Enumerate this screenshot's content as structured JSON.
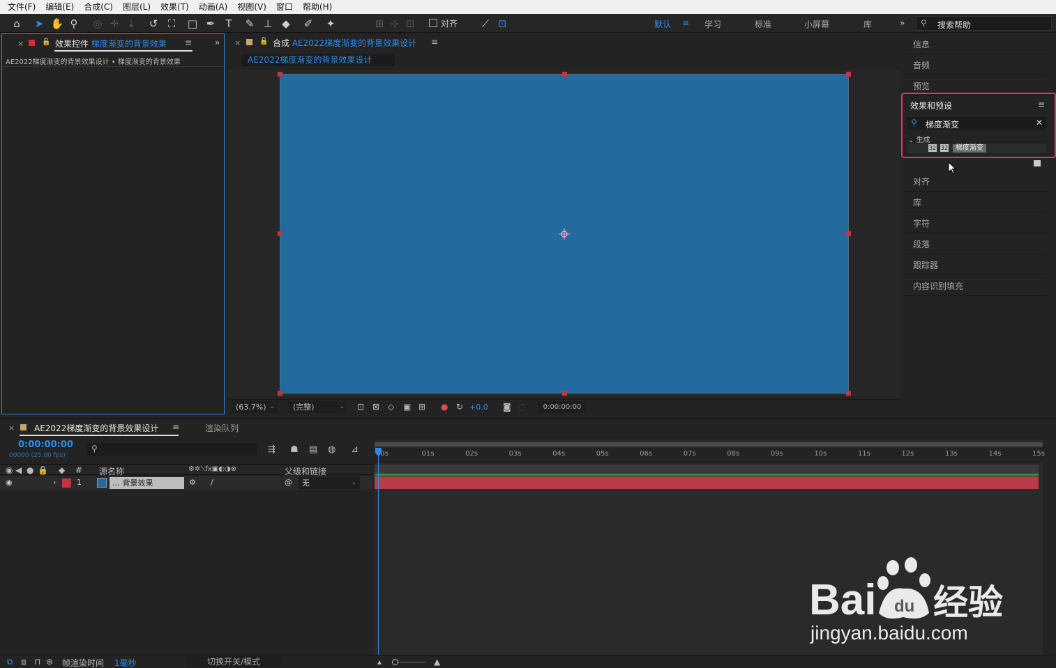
{
  "menu": [
    "文件(F)",
    "编辑(E)",
    "合成(C)",
    "图层(L)",
    "效果(T)",
    "动画(A)",
    "视图(V)",
    "窗口",
    "帮助(H)"
  ],
  "toolbar": {
    "align_label": "对齐",
    "workspaces": [
      "默认",
      "学习",
      "标准",
      "小屏幕",
      "库"
    ],
    "help_search": "搜索帮助",
    "icons": [
      "home-icon",
      "selection-arrow-icon",
      "hand-icon",
      "zoom-icon",
      "rotate-icon",
      "rectangle-icon",
      "pen-icon",
      "type-icon",
      "brush-icon",
      "stamp-icon",
      "eraser-icon",
      "puppet-icon",
      "pin-icon"
    ]
  },
  "effect_controls": {
    "tab_prefix": "效果控件",
    "tab_layer": "梯度渐变的背景效果",
    "subtitle": "AE2022梯度渐变的背景效果设计 • 梯度渐变的背景效果",
    "swatch_color": "#c8323a"
  },
  "composition": {
    "tab_prefix": "合成",
    "tab_name": "AE2022梯度渐变的背景效果设计",
    "breadcrumb": "AE2022梯度渐变的背景效果设计",
    "swatch_color": "#c9a66b",
    "background_color": "#236a9f",
    "zoom": "(63.7%)",
    "resolution": "(完整)",
    "exposure": "+0.0",
    "timecode": "0:00:00:00"
  },
  "right_panels": {
    "top": [
      "信息",
      "音频",
      "预览"
    ],
    "effects_presets": {
      "title": "效果和预设",
      "search_value": "梯度渐变",
      "category": "生成",
      "result": "梯度渐变"
    },
    "bottom": [
      "对齐",
      "库",
      "字符",
      "段落",
      "跟踪器",
      "内容识别填充"
    ]
  },
  "timeline": {
    "tab_name": "AE2022梯度渐变的背景效果设计",
    "render_queue": "渲染队列",
    "current_time": "0:00:00:00",
    "fps": "00000 (25.00 fps)",
    "col_source": "源名称",
    "col_hash": "#",
    "col_parent": "父级和链接",
    "layer": {
      "index": "1",
      "name": "… 背景效果",
      "parent": "无",
      "label_color": "#c8323a",
      "solid_color": "#236a9f"
    },
    "ruler": [
      "0s",
      "01s",
      "02s",
      "03s",
      "04s",
      "05s",
      "06s",
      "07s",
      "08s",
      "09s",
      "10s",
      "11s",
      "12s",
      "13s",
      "14s",
      "15s"
    ],
    "bar_color": "#b83c48"
  },
  "status": {
    "frame_render": "帧渲染时间",
    "frame_render_value": "1毫秒",
    "toggle_modes": "切换开关/模式"
  },
  "watermark": {
    "brand": "Bai",
    "brand2": "经验",
    "url": "jingyan.baidu.com"
  }
}
